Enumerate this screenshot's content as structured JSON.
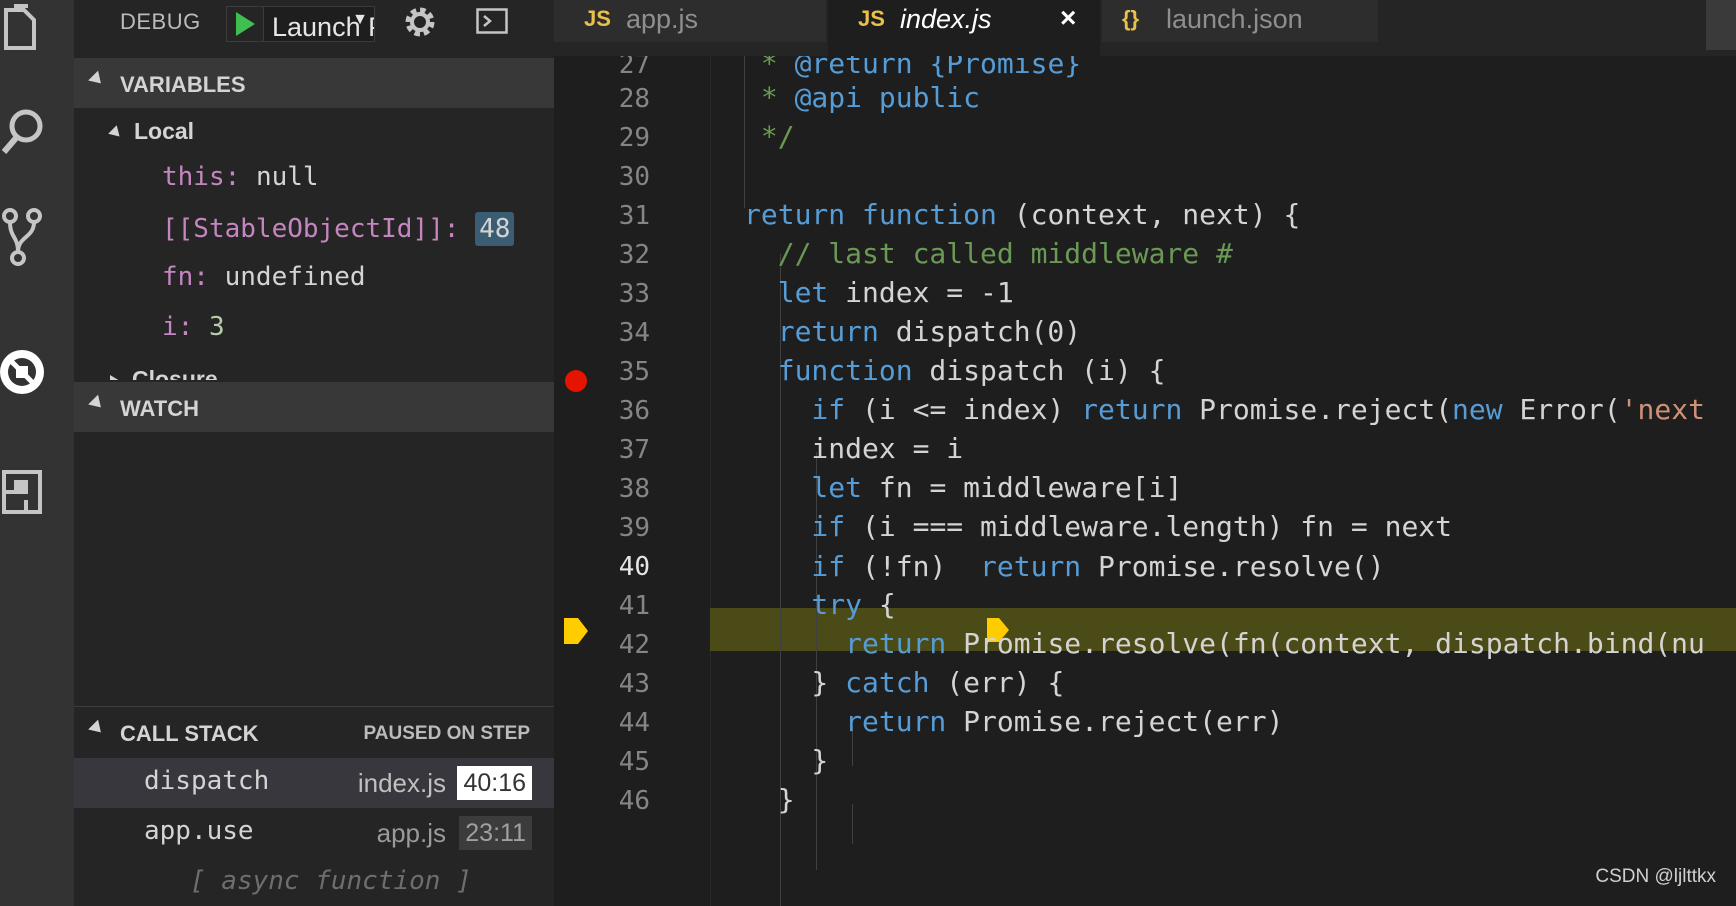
{
  "debug": {
    "title": "DEBUG",
    "config": "Launch Program"
  },
  "sections": {
    "variables": "VARIABLES",
    "watch": "WATCH",
    "callstack": "CALL STACK",
    "callstack_status": "PAUSED ON STEP"
  },
  "variables": {
    "scope": "Local",
    "items": [
      {
        "name": "this:",
        "value": "null"
      },
      {
        "name": "[[StableObjectId]]:",
        "value": "48"
      },
      {
        "name": "fn:",
        "value": "undefined"
      },
      {
        "name": "i:",
        "value": "3"
      }
    ],
    "collapsed_scope": "Closure"
  },
  "callstack": [
    {
      "fn": "dispatch",
      "file": "index.js",
      "pos": "40:16"
    },
    {
      "fn": "app.use",
      "file": "app.js",
      "pos": "23:11"
    }
  ],
  "callstack_async": "[ async function ]",
  "tabs": [
    {
      "icon": "JS",
      "label": "app.js"
    },
    {
      "icon": "JS",
      "label": "index.js",
      "close": "×"
    },
    {
      "icon": "{}",
      "label": "launch.json"
    }
  ],
  "lines": [
    "27",
    "28",
    "29",
    "30",
    "31",
    "32",
    "33",
    "34",
    "35",
    "36",
    "37",
    "38",
    "39",
    "40",
    "41",
    "42",
    "43",
    "44",
    "45",
    "46"
  ],
  "code": {
    "l27a": " * ",
    "l27b": "@return {Promise}",
    "l28a": " * ",
    "l28b": "@api public",
    "l29": " */",
    "l31a": "return function",
    "l31b": " (context, next) {",
    "l32": "  // last called middleware #",
    "l33a": "  let",
    "l33b": " index = -1",
    "l34a": "  return",
    "l34b": " dispatch(0)",
    "l35a": "  function",
    "l35b": " dispatch (i) {",
    "l36a": "    if",
    "l36b": " (i <= index) ",
    "l36c": "return",
    "l36d": " Promise.reject(",
    "l36e": "new",
    "l36f": " Error(",
    "l36g": "'next",
    "l37": "    index = i",
    "l38a": "    let",
    "l38b": " fn = middleware[i]",
    "l39a": "    if",
    "l39b": " (i === middleware.length) fn = next",
    "l40a": "    if",
    "l40b": " (!fn)  ",
    "l40c": "return",
    "l40d": " Promise.resolve()",
    "l41a": "    try",
    "l41b": " {",
    "l42a": "      return",
    "l42b": " Promise.resolve(fn(context, dispatch.bind(nu",
    "l43a": "    } ",
    "l43b": "catch",
    "l43c": " (err) {",
    "l44a": "      return",
    "l44b": " Promise.reject(err)",
    "l45": "    }",
    "l46": "  }"
  },
  "watermark": "CSDN @ljlttkx",
  "colors": {
    "breakpoint": "#e51400",
    "current_line": "#4b4b18",
    "pointer": "#ffcc00",
    "keyword": "#569cd6",
    "comment": "#6a9955"
  }
}
